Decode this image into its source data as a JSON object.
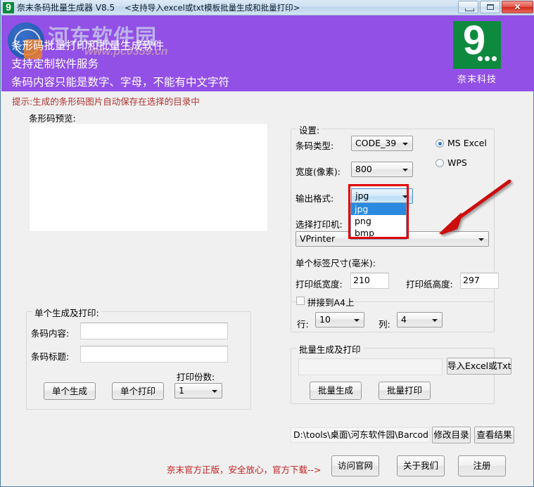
{
  "window": {
    "title": "奈末条码批量生成器 V8.5",
    "subtitle": "<支持导入excel或txt模板批量生成和批量打印>",
    "icon": "app-icon-9",
    "minimize_label": "",
    "maximize_label": "",
    "close_label": "✕"
  },
  "banner": {
    "color": "#9250e6",
    "lines": [
      "条形码批量打印和批量生成软件",
      "支持定制软件服务",
      "条码内容只能是数字、字母，不能有中文字符"
    ],
    "watermark_text": "河东软件园",
    "watermark_url": "www.pc0359.cn",
    "logo_digit": "9",
    "logo_caption": "奈末科技",
    "logo_color": "#0e8a3f"
  },
  "tip": "提示:生成的条形码图片自动保存在选择的目录中",
  "preview": {
    "label": "条形码预览:",
    "content": ""
  },
  "single": {
    "group_title": "单个生成及打印:",
    "content_label": "条码内容:",
    "content_value": "",
    "title_label": "条码标题:",
    "title_value": "",
    "copies_label": "打印份数:",
    "copies_value": "1",
    "generate_button": "单个生成",
    "print_button": "单个打印"
  },
  "settings": {
    "group_title": "设置:",
    "barcode_type_label": "条码类型:",
    "barcode_type_value": "CODE_39",
    "width_label": "宽度(像素):",
    "width_value": "800",
    "output_format_label": "输出格式:",
    "output_format_value": "jpg",
    "output_format_options": [
      "jpg",
      "png",
      "bmp"
    ],
    "printer_label": "选择打印机:",
    "printer_value": "VPrinter",
    "excel_engine": {
      "ms_excel": "MS  Excel",
      "wps": "WPS",
      "selected": "MS  Excel"
    },
    "label_size_title": "单个标签尺寸(毫米):",
    "paper_width_label": "打印纸宽度:",
    "paper_width_value": "210",
    "paper_height_label": "打印纸高度:",
    "paper_height_value": "297",
    "tile_a4_label": "拼接到A4上",
    "tile_a4_checked": false,
    "rows_label": "行:",
    "rows_value": "10",
    "cols_label": "列:",
    "cols_value": "4"
  },
  "batch": {
    "group_title": "批量生成及打印",
    "file_value": "",
    "import_button": "导入Excel或Txt",
    "generate_button": "批量生成",
    "print_button": "批量打印"
  },
  "output": {
    "path_value": "D:\\tools\\桌面\\河东软件园\\Barcod",
    "change_dir_button": "修改目录",
    "view_result_button": "查看结果"
  },
  "footer": {
    "note": "奈末官方正版，安全放心，官方下载-->",
    "visit_site_button": "访问官网",
    "about_button": "关于我们",
    "register_button": "注册"
  }
}
